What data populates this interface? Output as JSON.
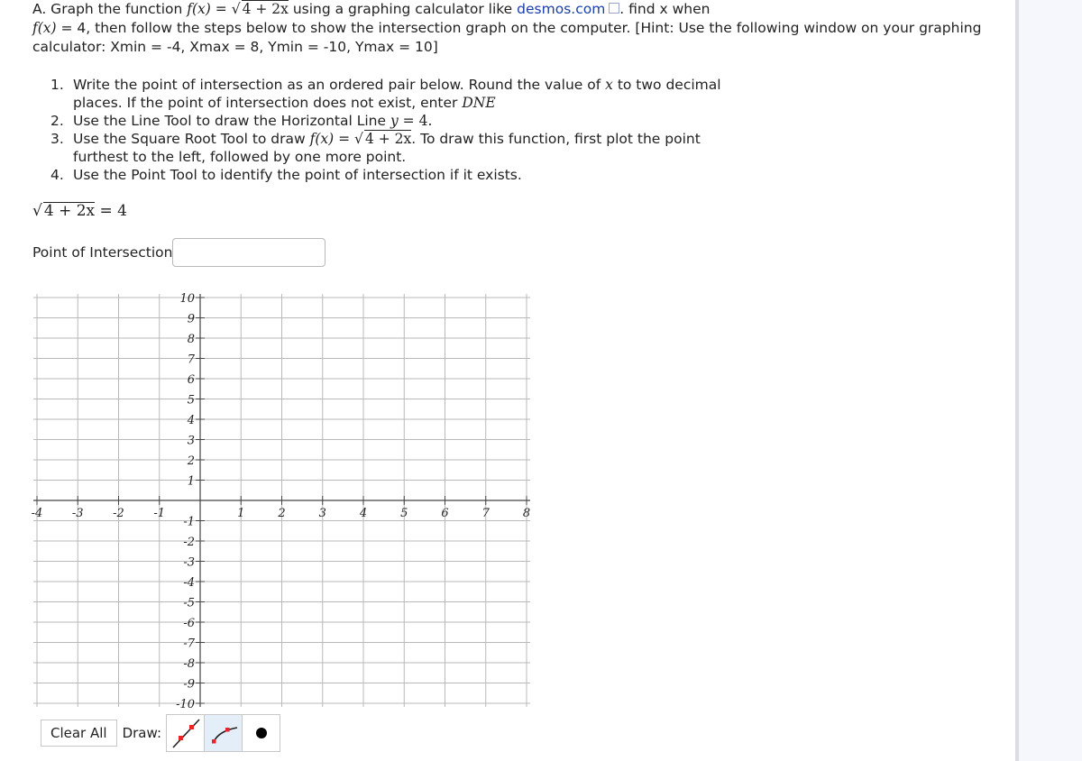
{
  "intro": {
    "p1": "A. Graph the function ",
    "fx": "f(x)",
    "eq": " = ",
    "sqrt_expr": "4 + 2x",
    "p2": " using a graphing calculator like ",
    "link": "desmos.com",
    "p3": ". find x when",
    "fx2": "f(x)",
    "p4": " = 4, then follow the steps below to show the intersection graph on the computer. [Hint: Use the following window on your graphing calculator: Xmin = -4, Xmax = 8, Ymin = -10, Ymax = 10]"
  },
  "steps": [
    {
      "num": "1.",
      "a": "Write the point of intersection as an ordered pair below. Round the value of ",
      "var": "x",
      "b": " to two decimal places. If the point of intersection does not exist, enter ",
      "dne": "DNE"
    },
    {
      "num": "2.",
      "a": "Use the Line Tool to draw the Horizontal Line ",
      "var": "y",
      "b": " = 4."
    },
    {
      "num": "3.",
      "a": "Use the Square Root Tool to draw ",
      "fx": "f(x)",
      "eq": " = ",
      "sqrt_expr": "4 + 2x",
      "b": ". To draw this function, first plot the point furthest to the left, followed by one more point."
    },
    {
      "num": "4.",
      "a": "Use the Point Tool to identify the point of intersection if it exists."
    }
  ],
  "equation": {
    "sqrt_expr": "4 + 2x",
    "rhs": " = 4"
  },
  "poi": {
    "label": "Point of Intersection:",
    "value": ""
  },
  "graph": {
    "xmin": -4,
    "xmax": 8,
    "ymin": -10,
    "ymax": 10,
    "x_ticks": [
      "-4",
      "-3",
      "-2",
      "-1",
      "1",
      "2",
      "3",
      "4",
      "5",
      "6",
      "7",
      "8"
    ],
    "y_ticks": [
      "10",
      "9",
      "8",
      "7",
      "6",
      "5",
      "4",
      "3",
      "2",
      "1",
      "-1",
      "-2",
      "-3",
      "-4",
      "-5",
      "-6",
      "-7",
      "-8",
      "-9",
      "-10"
    ]
  },
  "toolbar": {
    "clear_all": "Clear All",
    "draw_label": "Draw:",
    "tools": [
      {
        "name": "line-tool",
        "active": false
      },
      {
        "name": "square-root-tool",
        "active": true
      },
      {
        "name": "point-tool",
        "active": false
      }
    ]
  },
  "colors": {
    "link": "#1a3fa8",
    "tool_accent": "#e8232a",
    "active_tool_bg": "#e4eef8"
  }
}
